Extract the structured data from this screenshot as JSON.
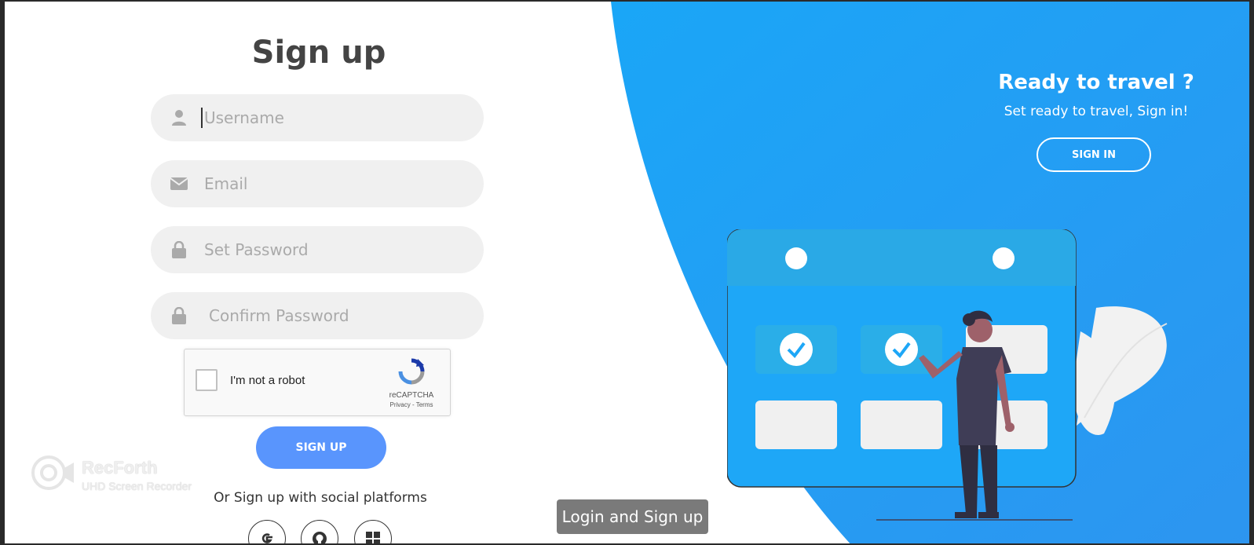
{
  "signup": {
    "title": "Sign up",
    "username_placeholder": "Username",
    "email_placeholder": "Email",
    "password_placeholder": "Set Password",
    "confirm_placeholder": "Confirm Password",
    "submit_label": "SIGN UP",
    "social_text": "Or Sign up with social platforms"
  },
  "captcha": {
    "label": "I'm not a robot",
    "brand": "reCAPTCHA",
    "links": "Privacy - Terms"
  },
  "panel": {
    "title": "Ready to travel ?",
    "subtitle": "Set ready to travel, Sign in!",
    "signin_label": "SIGN IN"
  },
  "watermark": {
    "title": "RecForth",
    "subtitle": "UHD Screen Recorder"
  },
  "tooltip": "Login and Sign up",
  "social_icons": [
    "google-icon",
    "github-icon",
    "microsoft-icon"
  ],
  "colors": {
    "primary": "#5995fd",
    "panel_blue": "#1ea7f7",
    "input_bg": "#f0f0f0"
  }
}
